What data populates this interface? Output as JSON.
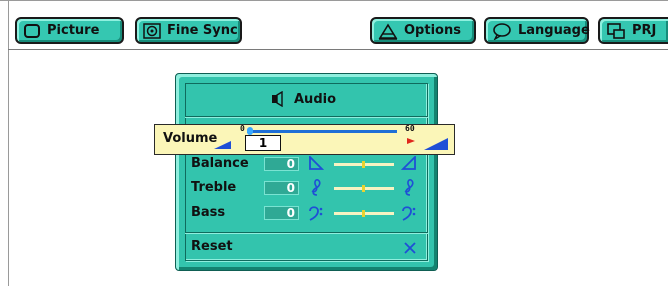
{
  "topbar": {
    "picture_label": "Picture",
    "fine_sync_label": "Fine Sync",
    "options_label": "Options",
    "language_label": "Language",
    "prj_label": "PRJ"
  },
  "panel": {
    "title": "Audio",
    "volume": {
      "label": "Volume",
      "value": "1",
      "min": "0",
      "max": "60",
      "level": 0.017
    },
    "balance": {
      "label": "Balance",
      "value": "0",
      "level": 0.5
    },
    "treble": {
      "label": "Treble",
      "value": "0",
      "level": 0.5
    },
    "bass": {
      "label": "Bass",
      "value": "0",
      "level": 0.5
    },
    "reset": {
      "label": "Reset",
      "icon": "x-icon"
    }
  },
  "colors": {
    "panel": "#33c4ad",
    "button": "#35c7b1",
    "highlight_row": "#fbf6b8",
    "slider_indicator": "#e8d330"
  }
}
